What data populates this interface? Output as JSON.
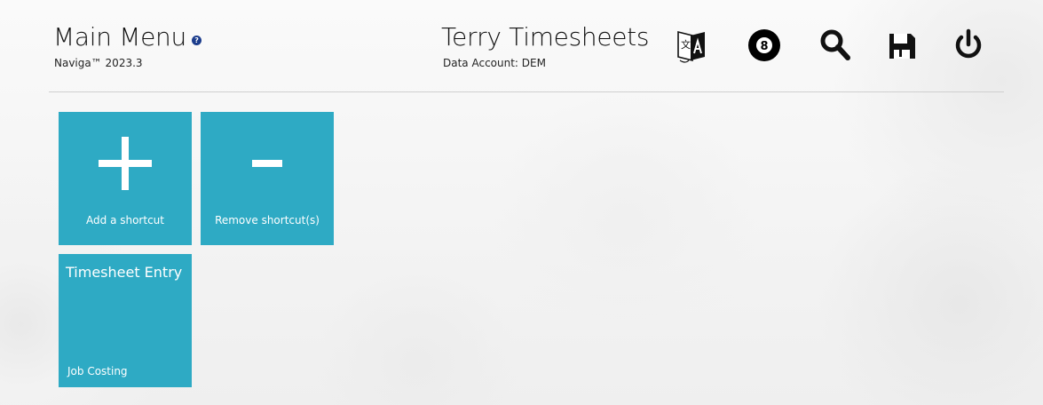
{
  "header": {
    "title": "Main Menu",
    "help_icon": "help-circle-icon",
    "version": "Naviga™ 2023.3",
    "user_name": "Terry Timesheets",
    "data_account": "Data Account: DEM"
  },
  "toolbar": {
    "buttons": [
      {
        "icon": "language-translate-icon"
      },
      {
        "icon": "eight-ball-icon"
      },
      {
        "icon": "search-icon"
      },
      {
        "icon": "save-disk-icon"
      },
      {
        "icon": "power-icon"
      }
    ]
  },
  "tiles": {
    "add": {
      "label": "Add a shortcut",
      "icon": "plus-icon"
    },
    "remove": {
      "label": "Remove shortcut(s)",
      "icon": "minus-icon"
    },
    "timesheet": {
      "title": "Timesheet Entry",
      "subtitle": "Job Costing"
    }
  },
  "colors": {
    "tile": "#2eaac4",
    "help_icon": "#1c3d8c"
  }
}
